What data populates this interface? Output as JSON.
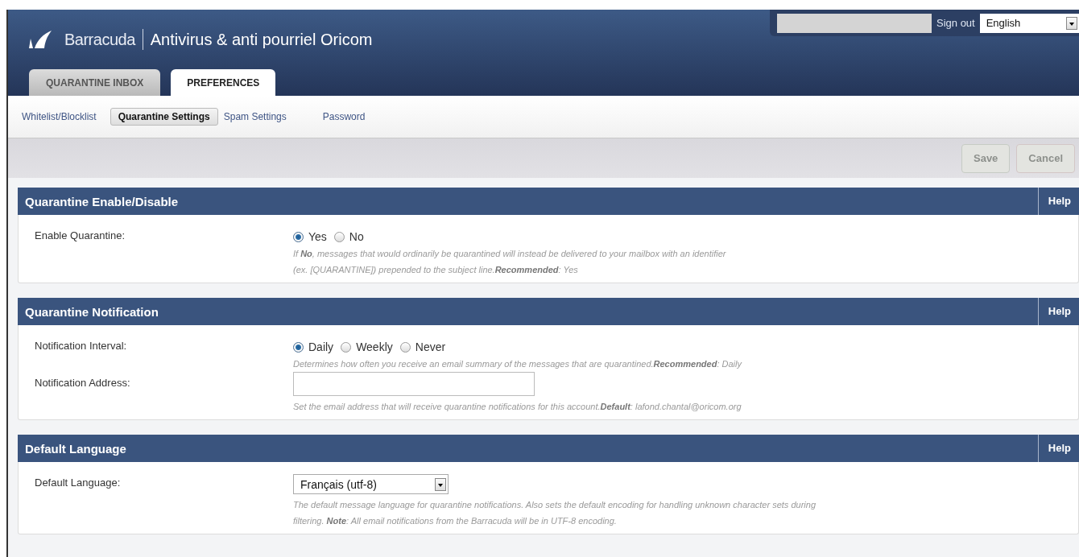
{
  "header": {
    "brand": "Barracuda",
    "title": "Antivirus & anti pourriel Oricom",
    "sign_out": "Sign out",
    "language": "English"
  },
  "tabs": [
    {
      "label": "QUARANTINE INBOX",
      "selected": false
    },
    {
      "label": "PREFERENCES",
      "selected": true
    }
  ],
  "subnav": [
    {
      "label": "Whitelist/Blocklist",
      "selected": false
    },
    {
      "label": "Quarantine Settings",
      "selected": true
    },
    {
      "label": "Spam Settings",
      "selected": false
    },
    {
      "label": "Password",
      "selected": false
    }
  ],
  "toolbar": [
    {
      "label": "Save",
      "disabled": true,
      "kind": "save"
    },
    {
      "label": "Cancel",
      "disabled": true,
      "kind": "cancel"
    }
  ],
  "sections": [
    {
      "title": "Quarantine Enable/Disable",
      "help": "Help",
      "rows": [
        {
          "kind": "radio",
          "label": "Enable Quarantine:",
          "options": [
            {
              "label": "Yes",
              "selected": true
            },
            {
              "label": "No",
              "selected": false
            }
          ],
          "hint": [
            "If **No**, messages that would ordinarily be quarantined will instead be delivered to your mailbox with an identifier",
            "(ex. [QUARANTINE]) prepended to the subject line.**Recommended**: Yes"
          ]
        }
      ]
    },
    {
      "title": "Quarantine Notification",
      "help": "Help",
      "rows": [
        {
          "kind": "radio",
          "label": "Notification Interval:",
          "options": [
            {
              "label": "Daily",
              "selected": true
            },
            {
              "label": "Weekly",
              "selected": false
            },
            {
              "label": "Never",
              "selected": false
            }
          ],
          "hint": [
            "Determines how often you receive an email summary of the messages that are quarantined.**Recommended**: Daily"
          ]
        },
        {
          "kind": "text",
          "label": "Notification Address:",
          "hint": [
            "Set the email address that will receive quarantine notifications for this account.**Default**: lafond.chantal@oricom.org"
          ]
        }
      ]
    },
    {
      "title": "Default Language",
      "help": "Help",
      "rows": [
        {
          "kind": "select",
          "label": "Default Language:",
          "value": "Français (utf-8)",
          "hint": [
            "The default message language for quarantine notifications. Also sets the default encoding for handling unknown character sets during",
            "filtering. **Note**: All email notifications from the Barracuda will be in UTF-8 encoding."
          ]
        }
      ]
    }
  ]
}
